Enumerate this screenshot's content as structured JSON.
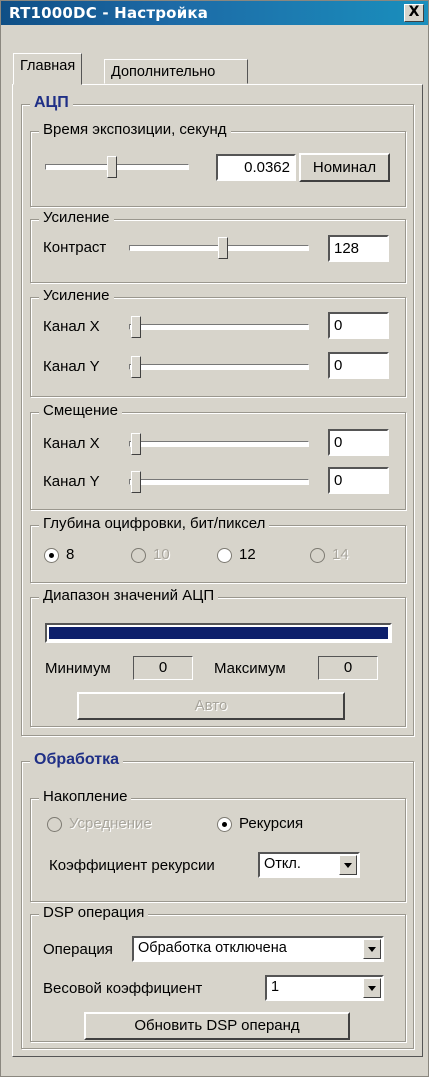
{
  "window": {
    "title": "RT1000DC - Настройка",
    "close_glyph": "X"
  },
  "tabs": [
    {
      "label": "Главная"
    },
    {
      "label": "Дополнительно"
    }
  ],
  "adc": {
    "title": "АЦП",
    "exposure": {
      "title": "Время экспозиции, секунд",
      "value": "0.0362",
      "nominal_label": "Номинал"
    },
    "gain": {
      "title": "Усиление",
      "contrast_label": "Контраст",
      "contrast_value": "128"
    },
    "channel_gain": {
      "title": "Усиление",
      "x_label": "Канал X",
      "x_value": "0",
      "y_label": "Канал Y",
      "y_value": "0"
    },
    "offset": {
      "title": "Смещение",
      "x_label": "Канал X",
      "x_value": "0",
      "y_label": "Канал Y",
      "y_value": "0"
    },
    "depth": {
      "title": "Глубина оцифровки, бит/пиксел",
      "options": [
        "8",
        "10",
        "12",
        "14"
      ],
      "selected": "8"
    },
    "range": {
      "title": "Диапазон значений АЦП",
      "min_label": "Минимум",
      "min_value": "0",
      "max_label": "Максимум",
      "max_value": "0",
      "auto_label": "Авто"
    }
  },
  "processing": {
    "title": "Обработка",
    "accumulation": {
      "title": "Накопление",
      "averaging_label": "Усреднение",
      "recursion_label": "Рекурсия",
      "coef_label": "Коэффициент рекурсии",
      "coef_value": "Откл."
    },
    "dsp": {
      "title": "DSP операция",
      "operation_label": "Операция",
      "operation_value": "Обработка отключена",
      "weight_label": "Весовой коэффициент",
      "weight_value": "1",
      "update_label": "Обновить DSP операнд"
    }
  }
}
